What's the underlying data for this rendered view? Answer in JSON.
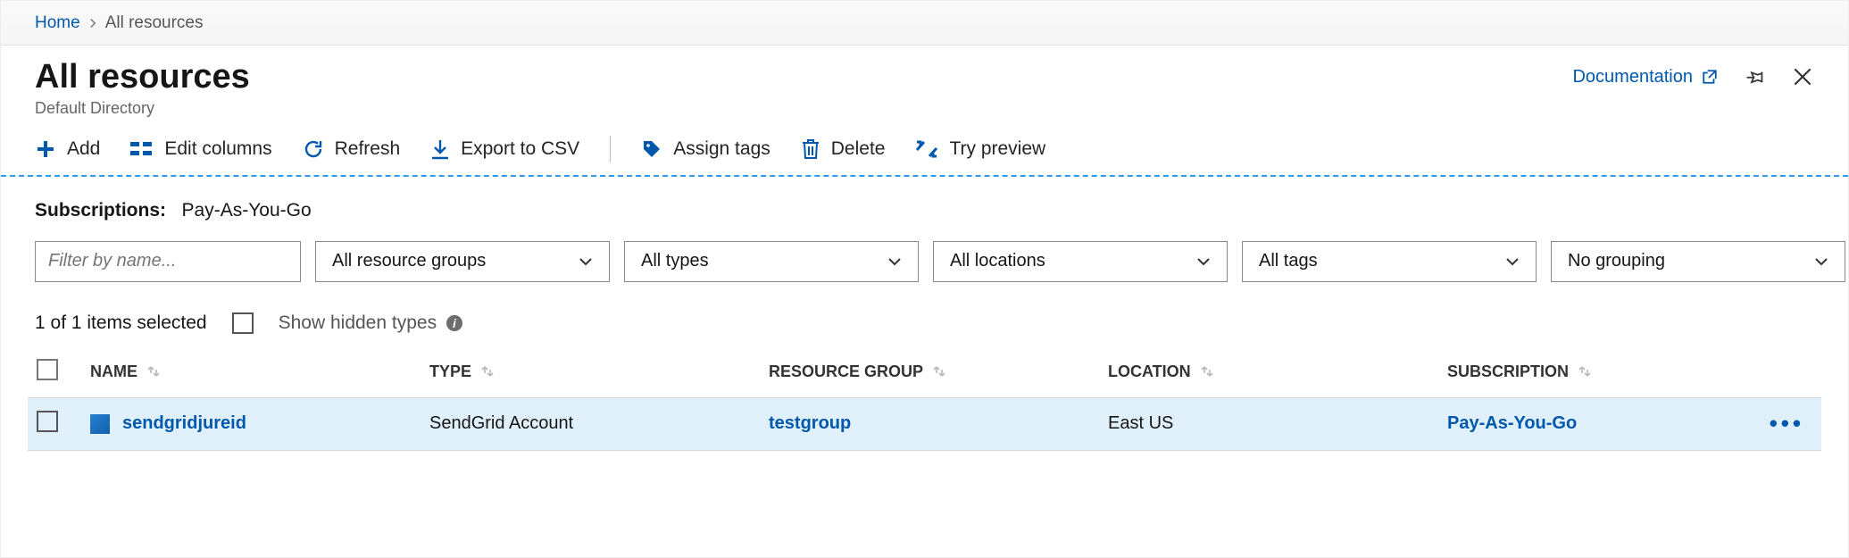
{
  "breadcrumb": {
    "home": "Home",
    "current": "All resources"
  },
  "title": {
    "main": "All resources",
    "subtitle": "Default Directory"
  },
  "header_actions": {
    "documentation": "Documentation"
  },
  "toolbar": {
    "add": "Add",
    "edit_columns": "Edit columns",
    "refresh": "Refresh",
    "export_csv": "Export to CSV",
    "assign_tags": "Assign tags",
    "delete": "Delete",
    "try_preview": "Try preview"
  },
  "subscriptions": {
    "label": "Subscriptions:",
    "value": "Pay-As-You-Go"
  },
  "filters": {
    "name_placeholder": "Filter by name...",
    "resource_groups": "All resource groups",
    "types": "All types",
    "locations": "All locations",
    "tags": "All tags",
    "grouping": "No grouping"
  },
  "selection": {
    "summary": "1 of 1 items selected",
    "show_hidden": "Show hidden types"
  },
  "table": {
    "columns": {
      "name": "NAME",
      "type": "TYPE",
      "resource_group": "RESOURCE GROUP",
      "location": "LOCATION",
      "subscription": "SUBSCRIPTION"
    },
    "rows": [
      {
        "name": "sendgridjureid",
        "type": "SendGrid Account",
        "resource_group": "testgroup",
        "location": "East US",
        "subscription": "Pay-As-You-Go"
      }
    ]
  }
}
